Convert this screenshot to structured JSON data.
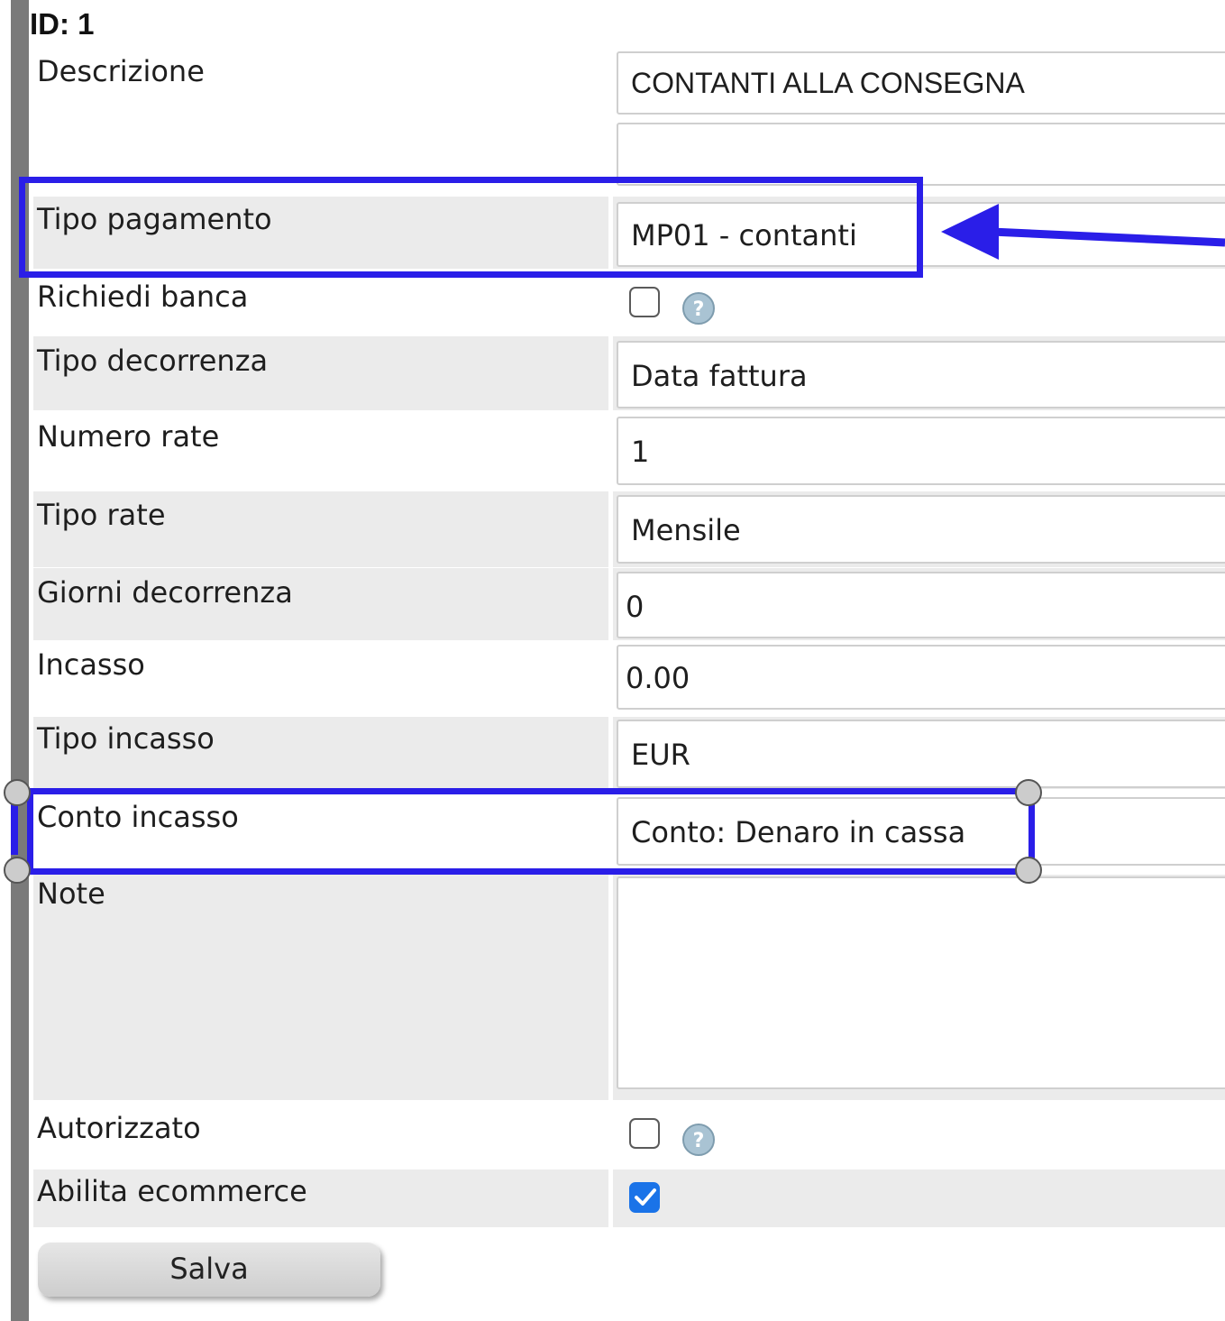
{
  "header": {
    "id_label": "ID: 1"
  },
  "form": {
    "descrizione": {
      "label": "Descrizione",
      "it_value": "CONTANTI ALLA CONSEGNA",
      "en_value": "",
      "it_flag": "italy-flag-icon",
      "en_flag": "uk-flag-icon"
    },
    "tipo_pagamento": {
      "label": "Tipo pagamento",
      "value": "MP01 - contanti"
    },
    "richiedi_banca": {
      "label": "Richiedi banca",
      "checked": false,
      "help_icon": "help-icon"
    },
    "tipo_decorrenza": {
      "label": "Tipo decorrenza",
      "value": "Data fattura"
    },
    "numero_rate": {
      "label": "Numero rate",
      "value": "1"
    },
    "tipo_rate": {
      "label": "Tipo rate",
      "value": "Mensile"
    },
    "giorni_decorrenza": {
      "label": "Giorni decorrenza",
      "value": "0"
    },
    "incasso": {
      "label": "Incasso",
      "value": "0.00"
    },
    "tipo_incasso": {
      "label": "Tipo incasso",
      "value": "EUR"
    },
    "conto_incasso": {
      "label": "Conto incasso",
      "value": "Conto: Denaro in cassa"
    },
    "note": {
      "label": "Note",
      "value": ""
    },
    "autorizzato": {
      "label": "Autorizzato",
      "checked": false,
      "help_icon": "help-icon"
    },
    "abilita_ecommerce": {
      "label": "Abilita ecommerce",
      "checked": true
    }
  },
  "actions": {
    "save_label": "Salva"
  },
  "annotations": {
    "color": "#2a1ee8",
    "arrow_icon": "arrow-left-icon"
  }
}
